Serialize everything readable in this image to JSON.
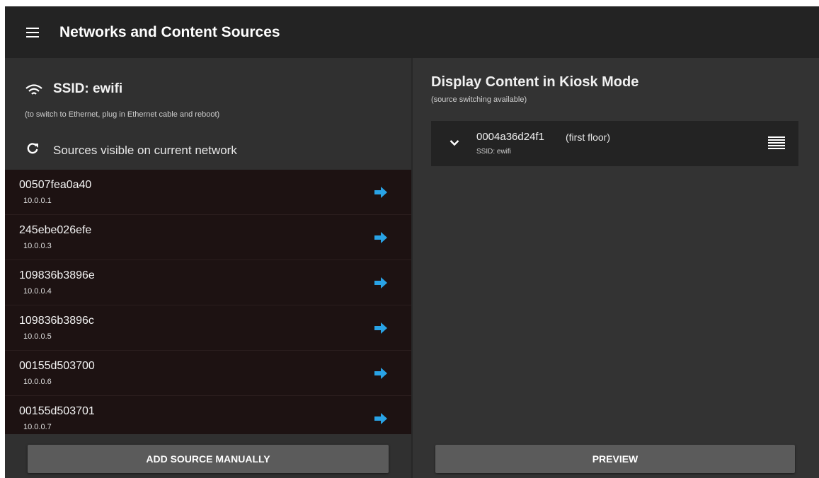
{
  "header": {
    "title": "Networks and Content Sources",
    "menu_icon": "hamburger-menu-icon"
  },
  "network": {
    "icon": "wifi-icon",
    "ssid_title": "SSID: ewifi",
    "hint": "(to switch to Ethernet, plug in Ethernet cable and reboot)",
    "refresh_icon": "refresh-icon",
    "sources_label": "Sources visible on current network"
  },
  "sources": [
    {
      "name": "00507fea0a40",
      "ip": "10.0.0.1"
    },
    {
      "name": "245ebe026efe",
      "ip": "10.0.0.3"
    },
    {
      "name": "109836b3896e",
      "ip": "10.0.0.4"
    },
    {
      "name": "109836b3896c",
      "ip": "10.0.0.5"
    },
    {
      "name": "00155d503700",
      "ip": "10.0.0.6"
    },
    {
      "name": "00155d503701",
      "ip": "10.0.0.7"
    }
  ],
  "add_source_label": "ADD SOURCE MANUALLY",
  "kiosk": {
    "title": "Display Content in Kiosk Mode",
    "subtitle": "(source switching available)",
    "card": {
      "name": "0004a36d24f1",
      "floor": "(first floor)",
      "ssid": "SSID: ewifi"
    },
    "preview_label": "PREVIEW"
  },
  "colors": {
    "arrow": "#29a3e6",
    "list_bg": "#1d1212",
    "topbar": "#232323"
  }
}
